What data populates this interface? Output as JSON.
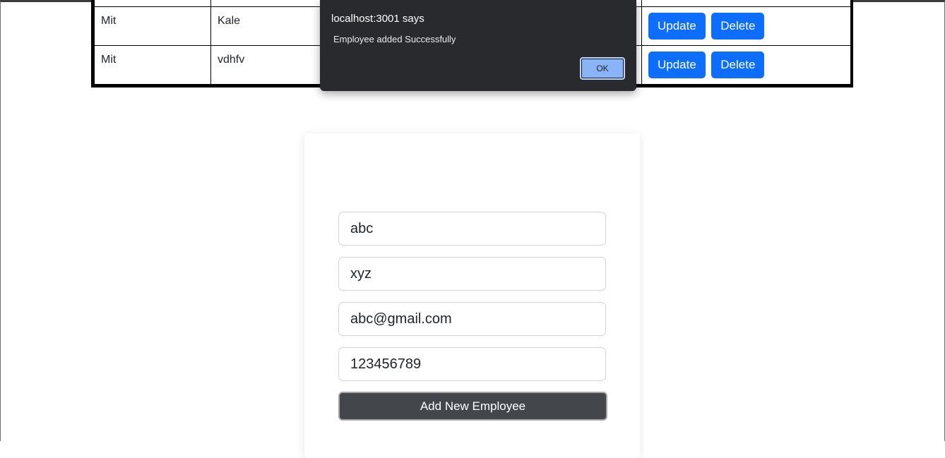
{
  "employees_table": {
    "rows": [
      {
        "first_name": "Mit",
        "last_name": "Kale",
        "update_label": "Update",
        "delete_label": "Delete"
      },
      {
        "first_name": "Mit",
        "last_name": "vdhfv",
        "update_label": "Update",
        "delete_label": "Delete"
      }
    ],
    "button_color": "#0d6efd"
  },
  "form": {
    "first_name_value": "abc",
    "last_name_value": "xyz",
    "email_value": "abc@gmail.com",
    "phone_value": "123456789",
    "submit_label": "Add New Employee",
    "submit_color": "#43474b"
  },
  "alert": {
    "title": "localhost:3001 says",
    "message": "Employee added Successfully",
    "ok_label": "OK",
    "ok_color": "#8ab4f8"
  }
}
